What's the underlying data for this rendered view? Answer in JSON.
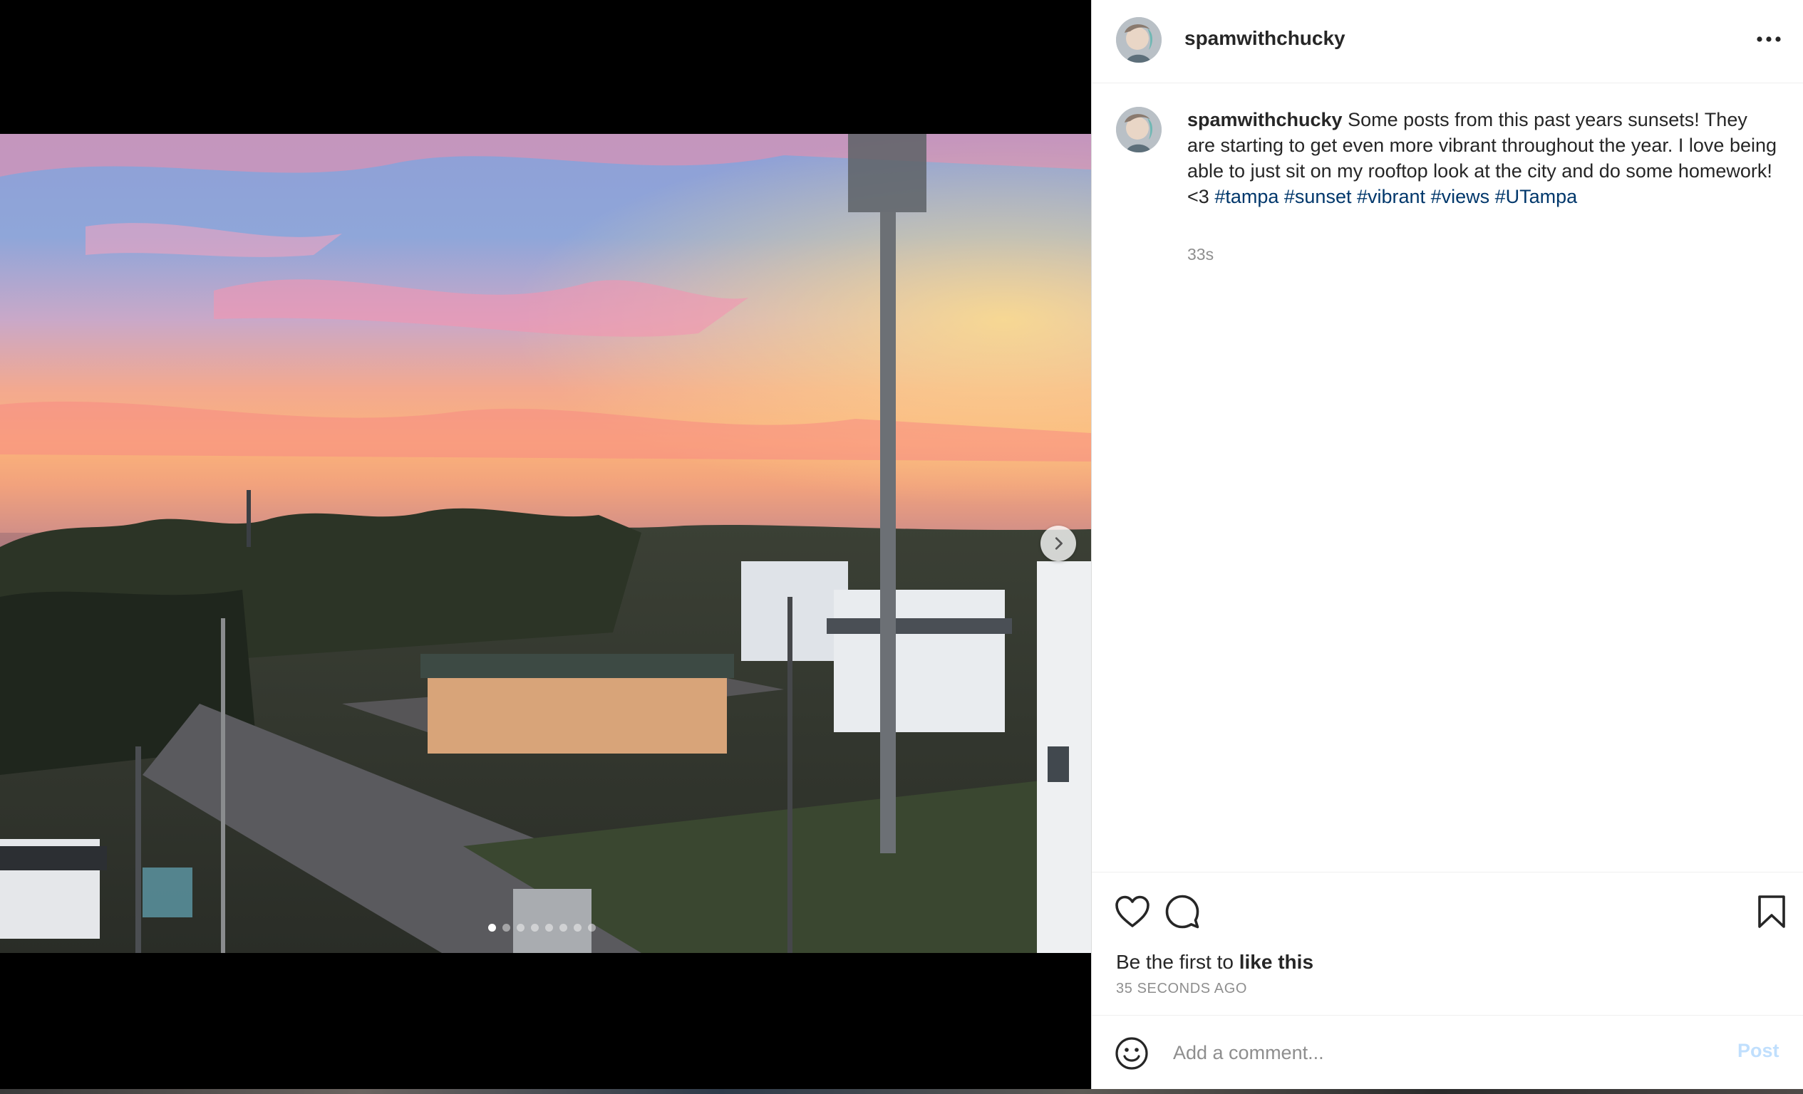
{
  "post": {
    "username": "spamwithchucky",
    "caption": {
      "username": "spamwithchucky",
      "text": "Some posts from this past years sunsets! They are starting to get even more vibrant throughout the year. I love being able to just sit on my rooftop look at the city and do some homework!<3",
      "hashtags": [
        "#tampa",
        "#sunset",
        "#vibrant",
        "#views",
        "#UTampa"
      ],
      "age": "33s"
    },
    "likes": {
      "prefix": "Be the first to ",
      "bold": "like this"
    },
    "timestamp": "35 SECONDS AGO"
  },
  "carousel": {
    "slide_count": 8,
    "active_index": 0
  },
  "comment": {
    "placeholder": "Add a comment...",
    "post_label": "Post"
  },
  "icons": {
    "more": "more-options-icon",
    "next": "chevron-right-icon",
    "like": "heart-icon",
    "comment": "comment-bubble-icon",
    "save": "bookmark-icon",
    "emoji": "emoji-smile-icon"
  },
  "colors": {
    "hashtag": "#00376b",
    "post_button_disabled": "#c0dffd",
    "secondary_text": "#8e8e8e"
  }
}
